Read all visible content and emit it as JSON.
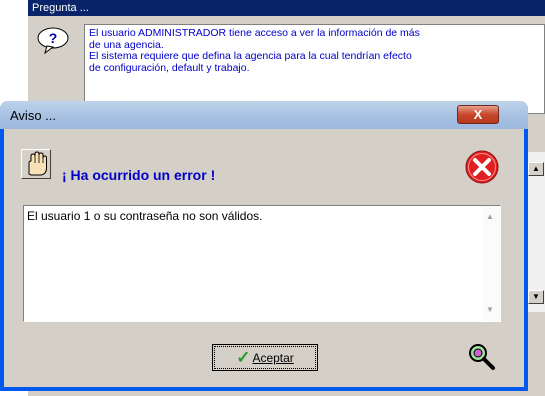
{
  "background_window": {
    "title": "Pregunta ...",
    "message_lines": [
      "El usuario ADMINISTRADOR tiene acceso a ver la información de más",
      "de una agencia.",
      "El sistema requiere que defina la agencia para la cual tendrían efecto",
      "de configuración, default y trabajo."
    ]
  },
  "dialog": {
    "title": "Aviso ...",
    "close_label": "X",
    "heading": "¡ Ha ocurrido un error !",
    "message": "El usuario 1 o su contraseña no son válidos.",
    "ok_label": "Aceptar"
  },
  "icons": [
    "question-icon",
    "hand-icon",
    "error-icon",
    "check-icon",
    "zoom-icon"
  ],
  "colors": {
    "titlebar_bg": "#0a246a",
    "message_text": "#0000c8",
    "dialog_frame": "#0058ee",
    "error_red": "#e02020"
  }
}
